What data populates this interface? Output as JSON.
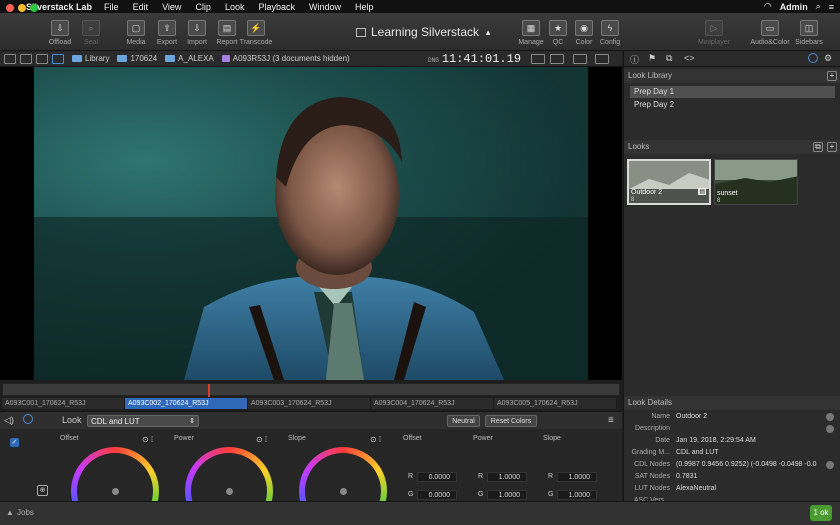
{
  "menubar": {
    "app_name": "Silverstack Lab",
    "items": [
      "File",
      "Edit",
      "View",
      "Clip",
      "Look",
      "Playback",
      "Window",
      "Help"
    ],
    "user": "Admin"
  },
  "toolbar": {
    "project_title": "Learning Silverstack",
    "buttons": {
      "offload": "Offload",
      "seal": "Seal",
      "media": "Media",
      "export": "Export",
      "import": "Import",
      "report": "Report",
      "transcode": "Transcode",
      "manage": "Manage",
      "qc": "QC",
      "color": "Color",
      "config": "Config",
      "miniplayer": "Miniplayer",
      "audio_color": "Audio&Color",
      "sidebars": "Sidebars"
    }
  },
  "pathbar": {
    "crumbs": [
      "Library",
      "170624",
      "A_ALEXA",
      "A093R53J (3 documents hidden)"
    ],
    "timecode_prefix": "DNG",
    "timecode": "11:41:01.19"
  },
  "timeline": {
    "playhead_fraction": 0.333,
    "clips": [
      "A093C001_170624_R53J",
      "A093C002_170624_R53J",
      "A093C003_170624_R53J",
      "A093C004_170624_R53J",
      "A093C005_170624_R53J"
    ],
    "active_index": 1
  },
  "grading": {
    "look_label": "Look",
    "look_mode": "CDL and LUT",
    "neutral_btn": "Neutral",
    "reset_btn": "Reset Colors",
    "wheels": [
      "Offset",
      "Power",
      "Slope"
    ],
    "columns": [
      {
        "title": "Offset",
        "R": "0.0000",
        "G": "0.0000"
      },
      {
        "title": "Power",
        "R": "1.0000",
        "G": "1.0000"
      },
      {
        "title": "Slope",
        "R": "1.0000",
        "G": "1.0000"
      }
    ],
    "channel_labels": [
      "R",
      "G"
    ]
  },
  "right_panel": {
    "look_library": {
      "title": "Look Library",
      "items": [
        "Prep Day 1",
        "Prep Day 2"
      ],
      "selected_index": 0
    },
    "looks": {
      "title": "Looks",
      "items": [
        {
          "name": "Outdoor 2",
          "num": "8"
        },
        {
          "name": "sunset",
          "num": "8"
        }
      ]
    },
    "look_details": {
      "title": "Look Details",
      "rows": [
        {
          "key": "Name",
          "value": "Outdoor 2"
        },
        {
          "key": "Description",
          "value": ""
        },
        {
          "key": "Date",
          "value": "Jan 19, 2018, 2:29:54 AM"
        },
        {
          "key": "Grading M...",
          "value": "CDL and LUT"
        },
        {
          "key": "CDL Nodes",
          "value": "(0.9987 0.9456 0.9252) (-0.0498 -0.0498 -0.0"
        },
        {
          "key": "SAT Nodes",
          "value": "0.7831"
        },
        {
          "key": "LUT Nodes",
          "value": "AlexaNeutral"
        },
        {
          "key": "ASC Vers...",
          "value": ""
        }
      ]
    }
  },
  "statusbar": {
    "jobs_label": "Jobs",
    "jobs_badge": "1 ok"
  },
  "colors": {
    "accent_blue": "#2f69b8",
    "playhead_red": "#e23b2d",
    "jobs_green": "#4a9c30"
  }
}
